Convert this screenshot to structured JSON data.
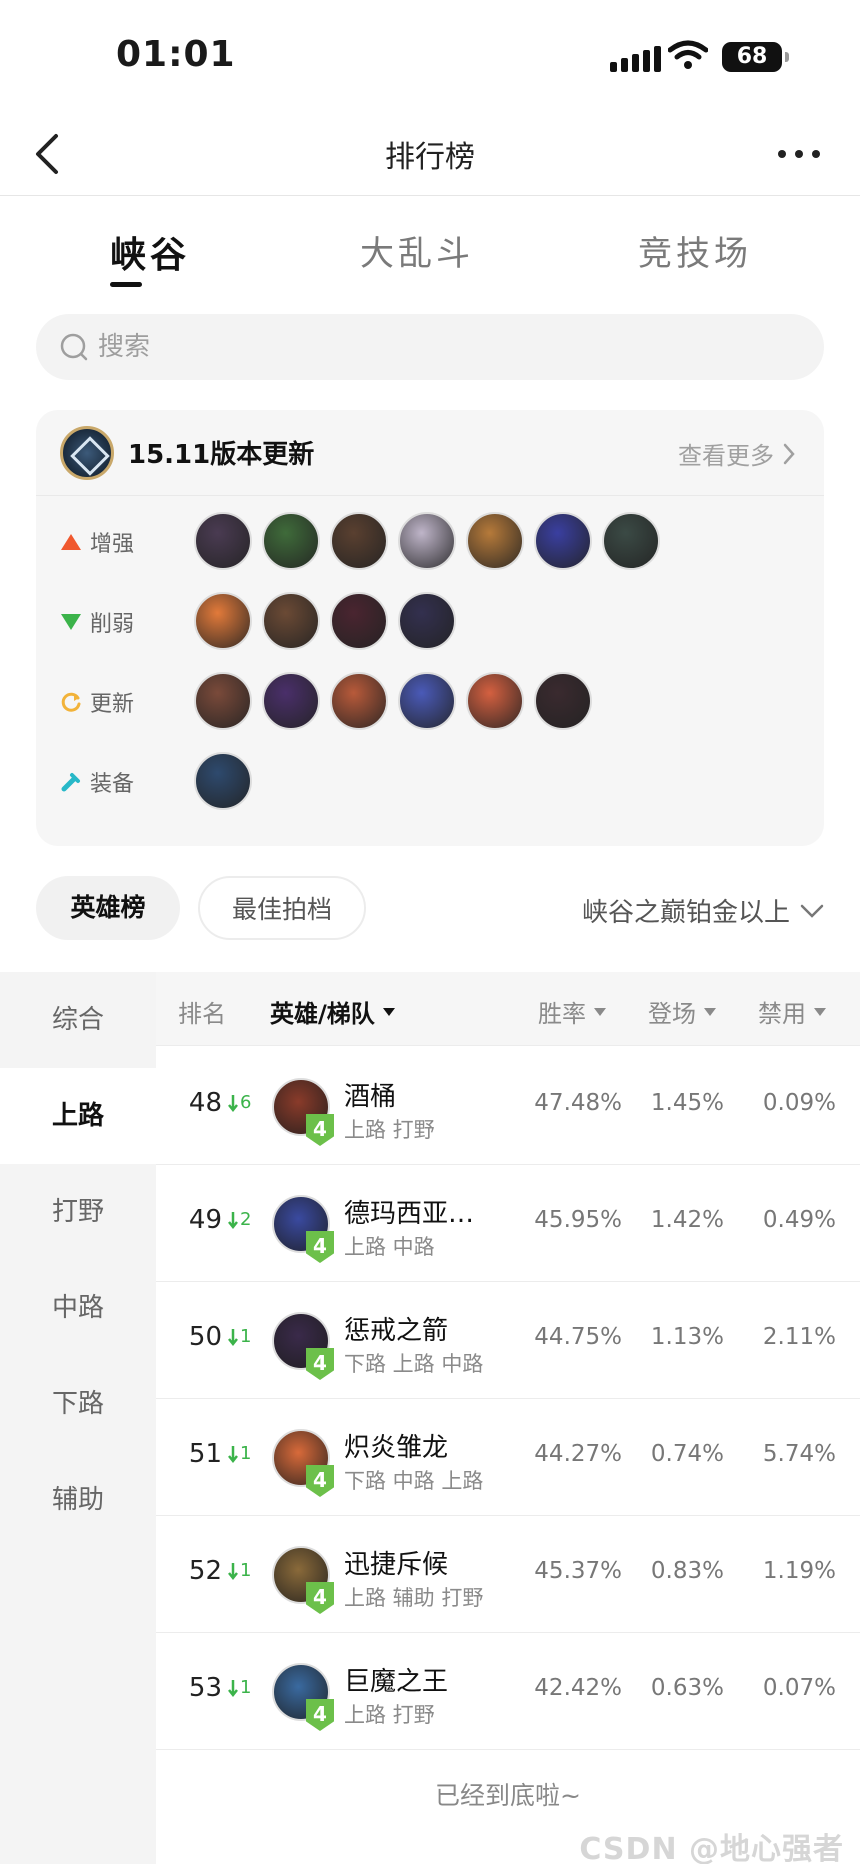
{
  "status_bar": {
    "time": "01:01",
    "battery": "68"
  },
  "navbar": {
    "title": "排行榜"
  },
  "modes": [
    "峡谷",
    "大乱斗",
    "竞技场"
  ],
  "search": {
    "placeholder": "搜索"
  },
  "version": {
    "title": "15.11版本更新",
    "more": "查看更多",
    "rows": [
      {
        "label": "增强",
        "icon": "up-triangle-icon",
        "color": "#f0582e",
        "heroes": [
          "#4a3b52",
          "#3f6b3a",
          "#5a4030",
          "#bfb5c9",
          "#b67a3a",
          "#3a3fa0",
          "#3b4a45"
        ]
      },
      {
        "label": "削弱",
        "icon": "down-triangle-icon",
        "color": "#3bb34a",
        "heroes": [
          "#e27a3a",
          "#6b4a35",
          "#4a2530",
          "#33304f"
        ]
      },
      {
        "label": "更新",
        "icon": "refresh-icon",
        "color": "#f2b33a",
        "heroes": [
          "#7a4a3a",
          "#4a2f6a",
          "#b85a3a",
          "#4a5ab8",
          "#d46040",
          "#3a2a2f"
        ]
      },
      {
        "label": "装备",
        "icon": "item-icon",
        "color": "#28b8c8",
        "heroes": [
          "#2e4a6e"
        ]
      }
    ]
  },
  "rank_tabs": {
    "active": "英雄榜",
    "other": "最佳拍档",
    "filter": "峡谷之巅铂金以上"
  },
  "sidebar": [
    "综合",
    "上路",
    "打野",
    "中路",
    "下路",
    "辅助"
  ],
  "table": {
    "headers": {
      "rank": "排名",
      "hero": "英雄/梯队",
      "win": "胜率",
      "pick": "登场",
      "ban": "禁用"
    },
    "rows": [
      {
        "rank": "48",
        "change": "6",
        "name": "酒桶",
        "positions": "上路 打野",
        "tier": "4",
        "win": "47.48%",
        "pick": "1.45%",
        "ban": "0.09%",
        "color": "#8a3b2a"
      },
      {
        "rank": "49",
        "change": "2",
        "name": "德玛西亚…",
        "positions": "上路 中路",
        "tier": "4",
        "win": "45.95%",
        "pick": "1.42%",
        "ban": "0.49%",
        "color": "#3a4aa0"
      },
      {
        "rank": "50",
        "change": "1",
        "name": "惩戒之箭",
        "positions": "下路 上路 中路",
        "tier": "4",
        "win": "44.75%",
        "pick": "1.13%",
        "ban": "2.11%",
        "color": "#3a2a4a"
      },
      {
        "rank": "51",
        "change": "1",
        "name": "炽炎雏龙",
        "positions": "下路 中路 上路",
        "tier": "4",
        "win": "44.27%",
        "pick": "0.74%",
        "ban": "5.74%",
        "color": "#d86a3a"
      },
      {
        "rank": "52",
        "change": "1",
        "name": "迅捷斥候",
        "positions": "上路 辅助 打野",
        "tier": "4",
        "win": "45.37%",
        "pick": "0.83%",
        "ban": "1.19%",
        "color": "#8a6a3a"
      },
      {
        "rank": "53",
        "change": "1",
        "name": "巨魔之王",
        "positions": "上路 打野",
        "tier": "4",
        "win": "42.42%",
        "pick": "0.63%",
        "ban": "0.07%",
        "color": "#3a6aa0"
      }
    ]
  },
  "end_text": "已经到底啦~",
  "watermark": "CSDN @地心强者"
}
